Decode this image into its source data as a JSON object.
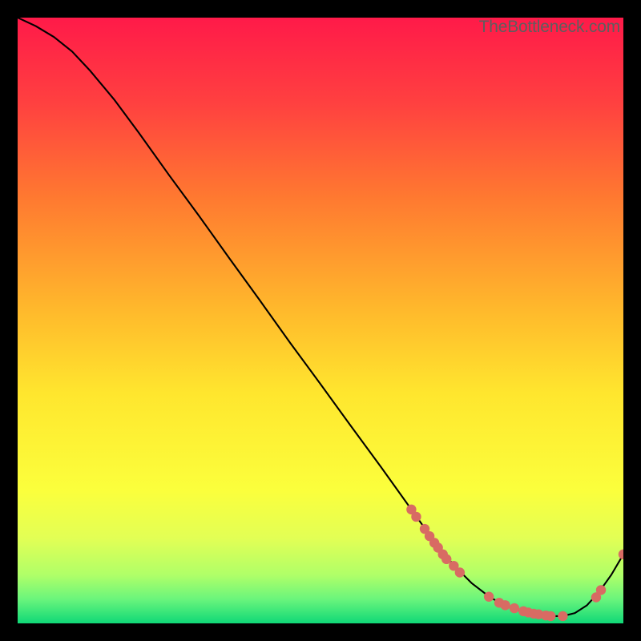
{
  "watermark": "TheBottleneck.com",
  "colors": {
    "gradient_top": "#ff1a49",
    "gradient_upper_mid": "#ff8a2a",
    "gradient_mid": "#ffe62e",
    "gradient_lower_mid": "#e8ff4a",
    "gradient_light": "#b5ff66",
    "gradient_bottom": "#11e07a",
    "curve": "#000000",
    "dot": "#d86b63"
  },
  "chart_data": {
    "type": "line",
    "title": "",
    "xlabel": "",
    "ylabel": "",
    "xlim": [
      0,
      100
    ],
    "ylim": [
      0,
      100
    ],
    "series": [
      {
        "name": "curve",
        "x": [
          0,
          3,
          6,
          9,
          12,
          16,
          20,
          25,
          30,
          35,
          40,
          45,
          50,
          55,
          60,
          65,
          68,
          70,
          72,
          75,
          78,
          80,
          82,
          84,
          86,
          88,
          90,
          92,
          94,
          96,
          98,
          100
        ],
        "y": [
          100,
          98.6,
          96.8,
          94.4,
          91.2,
          86.4,
          81,
          74,
          67.2,
          60.2,
          53.3,
          46.3,
          39.5,
          32.6,
          25.8,
          18.8,
          14.6,
          12.0,
          9.6,
          6.6,
          4.3,
          3.2,
          2.4,
          1.8,
          1.4,
          1.2,
          1.2,
          1.7,
          3.0,
          5.2,
          8.0,
          11.4
        ]
      }
    ],
    "scatter_points": {
      "x": [
        65.0,
        65.8,
        67.2,
        68.0,
        68.8,
        69.4,
        70.2,
        70.8,
        72.0,
        73.0,
        77.8,
        79.5,
        80.5,
        82.0,
        83.5,
        84.3,
        85.2,
        86.0,
        87.2,
        88.0,
        90.0,
        95.5,
        96.3,
        100.0
      ],
      "y": [
        18.8,
        17.6,
        15.6,
        14.4,
        13.3,
        12.5,
        11.4,
        10.6,
        9.5,
        8.4,
        4.4,
        3.4,
        3.0,
        2.5,
        2.0,
        1.8,
        1.6,
        1.5,
        1.3,
        1.2,
        1.2,
        4.3,
        5.5,
        11.4
      ]
    }
  }
}
